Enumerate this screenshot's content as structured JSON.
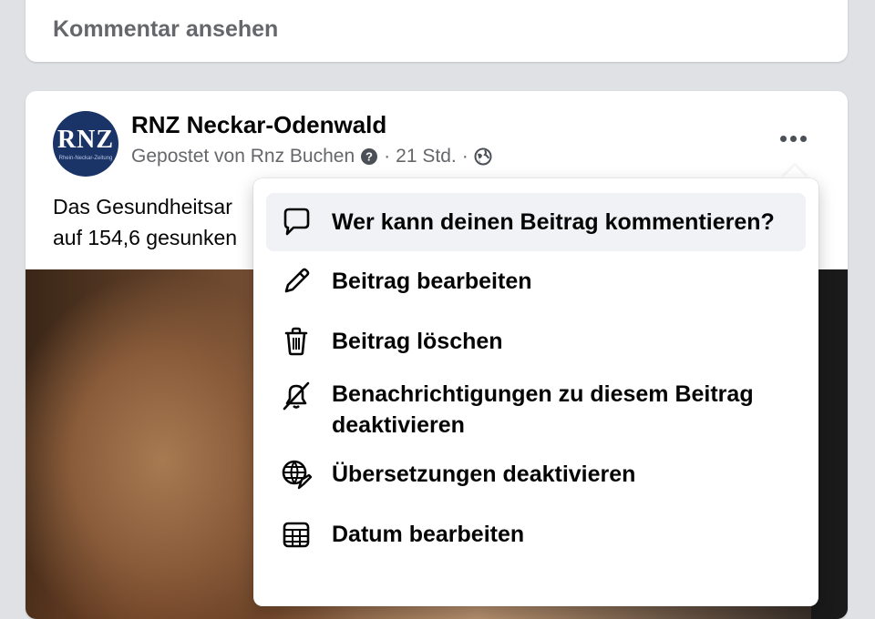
{
  "previous_post": {
    "view_comments_label": "Kommentar ansehen"
  },
  "post": {
    "page_name": "RNZ Neckar-Odenwald",
    "avatar_text": "RNZ",
    "avatar_subtext": "Rhein-Neckar-Zeitung",
    "posted_by": "Gepostet von Rnz Buchen",
    "separator": "·",
    "time": "21 Std.",
    "text_line1": "Das Gesundheitsar",
    "text_line2": "auf 154,6 gesunken"
  },
  "menu": {
    "items": [
      {
        "label": "Wer kann deinen Beitrag kommentieren?",
        "icon": "comment-icon"
      },
      {
        "label": "Beitrag bearbeiten",
        "icon": "pencil-icon"
      },
      {
        "label": "Beitrag löschen",
        "icon": "trash-icon"
      },
      {
        "label": "Benachrichtigungen zu diesem Beitrag deaktivieren",
        "icon": "bell-off-icon"
      },
      {
        "label": "Übersetzungen deaktivieren",
        "icon": "globe-translate-icon"
      },
      {
        "label": "Datum bearbeiten",
        "icon": "calendar-icon"
      }
    ]
  },
  "colors": {
    "background": "#dfe1e5",
    "card": "#ffffff",
    "secondary_text": "#65676b",
    "avatar_bg": "#1a3468",
    "hover_item": "#f0f2f5"
  }
}
